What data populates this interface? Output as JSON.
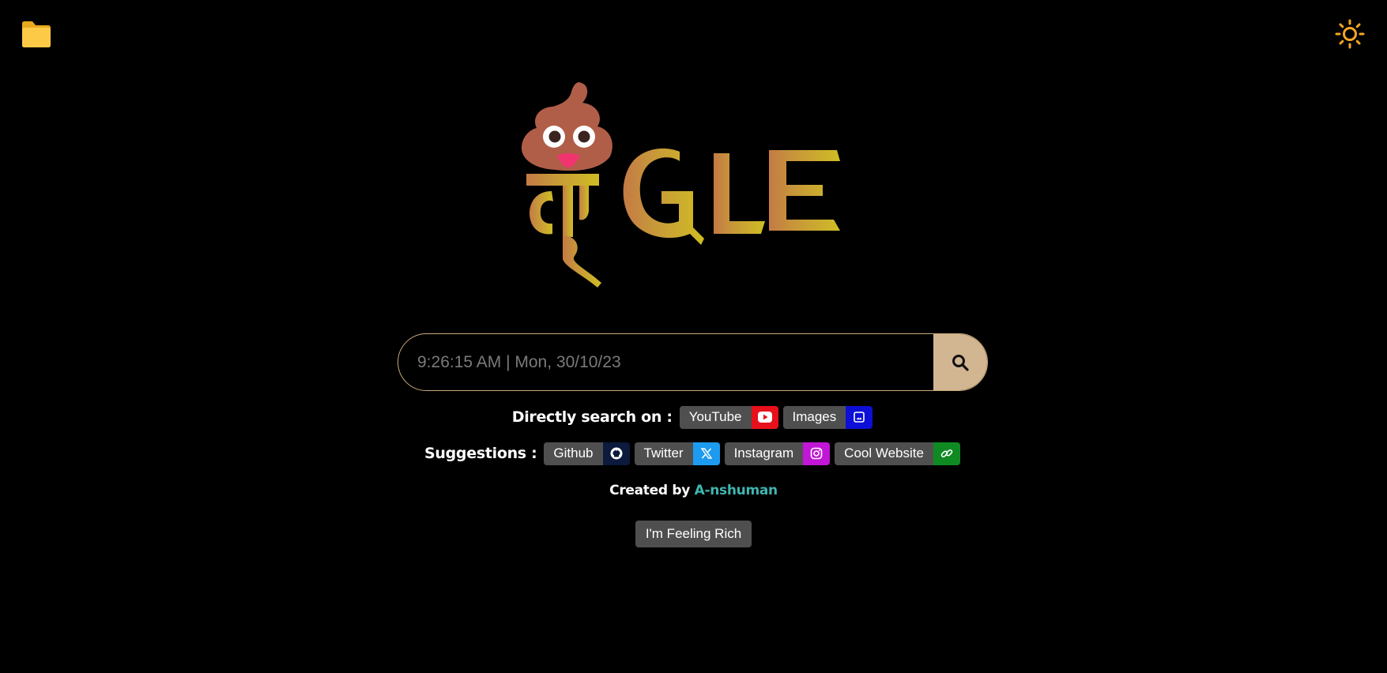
{
  "search": {
    "placeholder": "9:26:15 AM | Mon, 30/10/23"
  },
  "direct_search": {
    "label": "Directly search on :",
    "items": [
      {
        "label": "YouTube",
        "icon": "youtube-icon",
        "color": "#e8111b"
      },
      {
        "label": "Images",
        "icon": "image-icon",
        "color": "#0d0fd6"
      }
    ]
  },
  "suggestions": {
    "label": "Suggestions :",
    "items": [
      {
        "label": "Github",
        "icon": "github-icon",
        "color": "#0c1a3d"
      },
      {
        "label": "Twitter",
        "icon": "x-icon",
        "color": "#1d9bf0"
      },
      {
        "label": "Instagram",
        "icon": "instagram-icon",
        "color": "#c216d6"
      },
      {
        "label": "Cool Website",
        "icon": "link-icon",
        "color": "#0f8a23"
      }
    ]
  },
  "credit": {
    "prefix": "Created by",
    "author": "A-nshuman"
  },
  "lucky_button": {
    "label": "I'm Feeling Rich"
  },
  "colors": {
    "accent": "#d2b591",
    "folder": "#f8c445",
    "sun": "#f6a623"
  }
}
